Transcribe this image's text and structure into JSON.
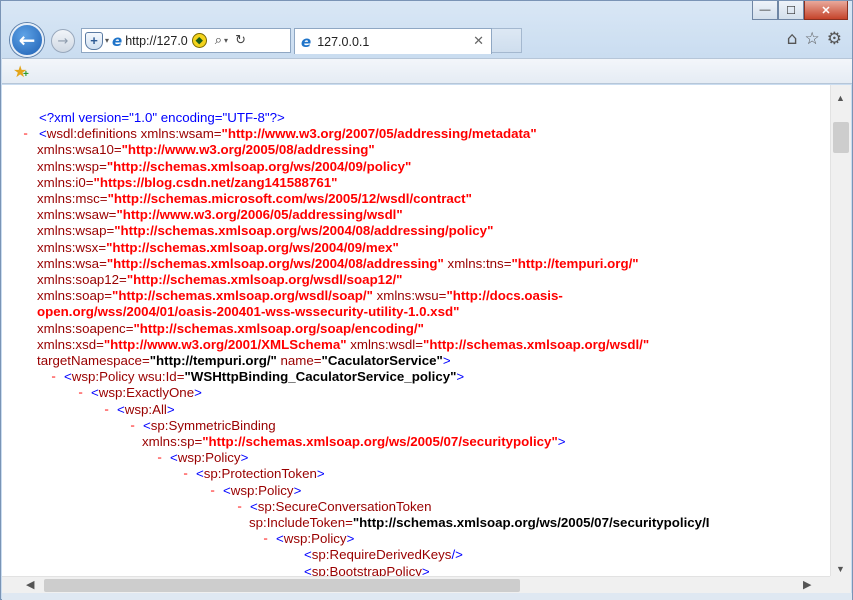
{
  "window": {
    "minimize": "—",
    "maximize": "☐",
    "close": "✕"
  },
  "nav": {
    "back_icon": "back-arrow-icon",
    "back": "←",
    "forward": "→",
    "forward_icon": "forward-arrow-icon"
  },
  "address": {
    "url": "http://127.0",
    "shield_glyph": "+",
    "dropdown": "▾",
    "search": "⌕",
    "refresh": "↻",
    "compat": "◆"
  },
  "tab": {
    "title": "127.0.0.1",
    "close": "✕",
    "icon": "ie-logo-icon"
  },
  "tools": {
    "home": "⌂",
    "favorites": "☆",
    "settings": "⚙"
  },
  "favbar": {
    "star": "★",
    "plus": "+"
  },
  "scroll": {
    "up": "▲",
    "down": "▼",
    "left": "◀",
    "right": "▶"
  },
  "xml": {
    "l0": [
      "<?xml version=\"1.0\" encoding=\"UTF-8\"?>"
    ],
    "l1": {
      "collapse": "-",
      "open": "<",
      "tag": "wsdl:definitions",
      "attr": " xmlns:wsam=",
      "val": "\"http://www.w3.org/2007/05/addressing/metadata\""
    },
    "l2": {
      "attr": "xmlns:wsa10=",
      "val": "\"http://www.w3.org/2005/08/addressing\""
    },
    "l3": {
      "attr": "xmlns:wsp=",
      "val": "\"http://schemas.xmlsoap.org/ws/2004/09/policy\""
    },
    "l4": {
      "attr": "xmlns:i0=",
      "val": "\"https://blog.csdn.net/zang141588761\""
    },
    "l5": {
      "attr": "xmlns:msc=",
      "val": "\"http://schemas.microsoft.com/ws/2005/12/wsdl/contract\""
    },
    "l6": {
      "attr": "xmlns:wsaw=",
      "val": "\"http://www.w3.org/2006/05/addressing/wsdl\""
    },
    "l7": {
      "attr": "xmlns:wsap=",
      "val": "\"http://schemas.xmlsoap.org/ws/2004/08/addressing/policy\""
    },
    "l8": {
      "attr": "xmlns:wsx=",
      "val": "\"http://schemas.xmlsoap.org/ws/2004/09/mex\""
    },
    "l9": {
      "attr": "xmlns:wsa=",
      "val": "\"http://schemas.xmlsoap.org/ws/2004/08/addressing\"",
      "attr2": " xmlns:tns=",
      "val2": "\"http://tempuri.org/\""
    },
    "l10": {
      "attr": "xmlns:soap12=",
      "val": "\"http://schemas.xmlsoap.org/wsdl/soap12/\""
    },
    "l11": {
      "attr": "xmlns:soap=",
      "val": "\"http://schemas.xmlsoap.org/wsdl/soap/\"",
      "attr2": " xmlns:wsu=",
      "val2": "\"http://docs.oasis-"
    },
    "l12": {
      "val": "open.org/wss/2004/01/oasis-200401-wss-wssecurity-utility-1.0.xsd\""
    },
    "l13": {
      "attr": "xmlns:soapenc=",
      "val": "\"http://schemas.xmlsoap.org/soap/encoding/\""
    },
    "l14": {
      "attr": "xmlns:xsd=",
      "val": "\"http://www.w3.org/2001/XMLSchema\"",
      "attr2": " xmlns:wsdl=",
      "val2": "\"http://schemas.xmlsoap.org/wsdl/\""
    },
    "l15": {
      "attr": "targetNamespace=",
      "val": "\"http://tempuri.org/\"",
      "attr2": " name=",
      "val2": "\"CaculatorService\"",
      "close": ">"
    },
    "l16": {
      "collapse": "-",
      "open": "<",
      "tag": "wsp:Policy",
      "attr": " wsu:Id=",
      "val": "\"WSHttpBinding_CaculatorService_policy\"",
      "close": ">"
    },
    "l17": {
      "collapse": "-",
      "open": "<",
      "tag": "wsp:ExactlyOne",
      "close": ">"
    },
    "l18": {
      "collapse": "-",
      "open": "<",
      "tag": "wsp:All",
      "close": ">"
    },
    "l19": {
      "collapse": "-",
      "open": "<",
      "tag": "sp:SymmetricBinding"
    },
    "l20": {
      "attr": "xmlns:sp=",
      "val": "\"http://schemas.xmlsoap.org/ws/2005/07/securitypolicy\"",
      "close": ">"
    },
    "l21": {
      "collapse": "-",
      "open": "<",
      "tag": "wsp:Policy",
      "close": ">"
    },
    "l22": {
      "collapse": "-",
      "open": "<",
      "tag": "sp:ProtectionToken",
      "close": ">"
    },
    "l23": {
      "collapse": "-",
      "open": "<",
      "tag": "wsp:Policy",
      "close": ">"
    },
    "l24": {
      "collapse": "-",
      "open": "<",
      "tag": "sp:SecureConversationToken"
    },
    "l25": {
      "attr": "sp:IncludeToken=",
      "val": "\"http://schemas.xmlsoap.org/ws/2005/07/securitypolicy/I"
    },
    "l26": {
      "collapse": "-",
      "open": "<",
      "tag": "wsp:Policy",
      "close": ">"
    },
    "l27": {
      "open": "<",
      "tag": "sp:RequireDerivedKeys",
      "close": "/>"
    },
    "l28": {
      "open": "<",
      "tag": "sp:BootstrapPolicy",
      "close": ">"
    }
  }
}
